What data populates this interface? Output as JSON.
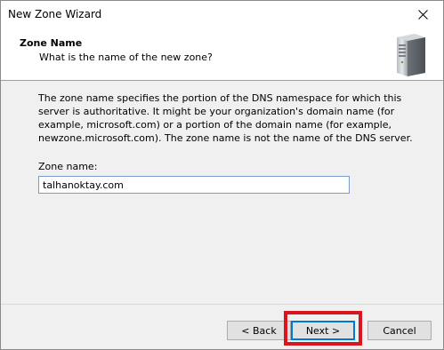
{
  "window": {
    "title": "New Zone Wizard"
  },
  "header": {
    "title": "Zone Name",
    "subtitle": "What is the name of the new zone?"
  },
  "body": {
    "description": "The zone name specifies the portion of the DNS namespace for which this server is authoritative. It might be your organization's domain name (for example,  microsoft.com) or a portion of the domain name (for example, newzone.microsoft.com). The zone name is not the name of the DNS server.",
    "zone_label": "Zone name:",
    "zone_value": "talhanoktay.com"
  },
  "footer": {
    "back_label": "< Back",
    "next_label": "Next >",
    "cancel_label": "Cancel"
  },
  "colors": {
    "highlight": "#d9161f",
    "focus_border": "#0078d7"
  },
  "icons": {
    "close": "close-icon",
    "server": "server-icon"
  }
}
